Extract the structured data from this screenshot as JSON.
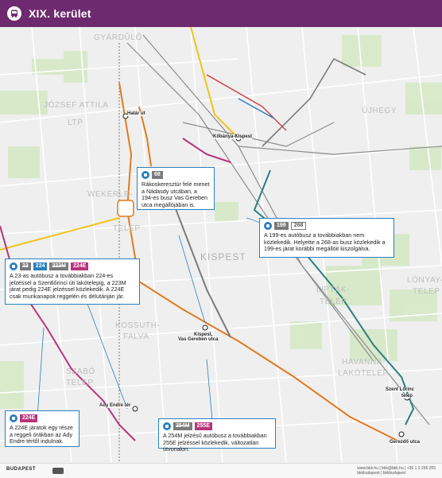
{
  "header": {
    "title": "XIX. kerület"
  },
  "districts": {
    "gyardulo": "GYÁRDŰLŐ",
    "jozsef_attila": "JÓZSEF ATTILA",
    "ltp": "LTP",
    "ujhegy": "ÚJHEGY",
    "wekerle": "WEKERLE-",
    "telep": "TELEP",
    "kispest": "KISPEST",
    "kossuth": "KOSSUTH-",
    "falva": "FALVA",
    "szabo": "SZABÓ",
    "szabo_telep": "TELEP",
    "liptak": "LIPTÁK-",
    "liptak_telep": "TELEP",
    "lonyay": "LÓNYAY-",
    "lonyay_telep": "TELEP",
    "havanna": "HAVANNA-",
    "lakotelep": "LAKÓTELEP"
  },
  "stops": {
    "hatar_ut": "Határ út",
    "kobanya": "Kőbánya-Kispest",
    "kispest_vg1": "Kispest,",
    "kispest_vg2": "Vas Gereben utca",
    "ady": "Ady Endre tér",
    "szent_lorinc1": "Szent Lőrinc",
    "szent_lorinc2": "telep",
    "gerezdo": "Gerezdő utca"
  },
  "box68": {
    "route": "68",
    "text": "Rákoskeresztúr felé menet a Nádasdy utcában, a 194-es busz Vas Gereben utca megállójában is."
  },
  "box199": {
    "route1": "199",
    "route2": "268",
    "text": "A 199-es autóbusz a továbbiakban nem közlekedik. Helyette a 268-as busz közlekedik a 199-es járat korábbi megállóit kiszolgálva."
  },
  "box23": {
    "route1": "23",
    "route2": "224",
    "route3": "223M",
    "route4": "224E",
    "text": "A 23-as autóbusz a továbbiakban 224-es jelzéssel a Szentlőrinci úti lakótelepig, a 223M járat pedig 224E jelzéssel közlekedik. A 224E csak munkanapok reggelén és délutánján jár."
  },
  "box224e": {
    "route": "224E",
    "text": "A 224E járatok egy része a reggeli órákban az Ady Endre tértől indulnak."
  },
  "box254": {
    "route1": "254M",
    "route2": "255E",
    "text": "A 254M jelzésű autóbusz a továbbiakban 255E jelzéssel közlekedik, változatlan útvonalon."
  },
  "footer": {
    "logo": "BUDAPEST",
    "web": "www.bkk.hu | bkk@bkk.hu | +36 1 3 255 255",
    "social": "bkkbudapest | bkkbudapest"
  },
  "colors": {
    "header": "#6d2a6e",
    "info_border": "#2a7fc0",
    "route_orange": "#e07b1f",
    "route_magenta": "#b8347c",
    "route_teal": "#2b7f7f",
    "tram": "#f0c419"
  }
}
